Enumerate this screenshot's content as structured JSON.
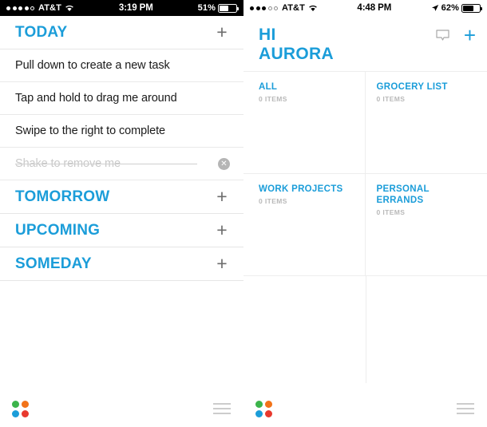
{
  "left_phone": {
    "status_bar": {
      "signal_dots_filled": 4,
      "signal_dots_total": 5,
      "carrier": "AT&T",
      "wifi_icon": "wifi-icon",
      "time": "3:19 PM",
      "battery_percent": "51%",
      "battery_level": 51,
      "theme": "dark"
    },
    "sections": [
      {
        "title": "TODAY",
        "add_icon": "plus-icon",
        "tasks": [
          {
            "text": "Pull down to create a new task",
            "done": false
          },
          {
            "text": "Tap and hold to drag me around",
            "done": false
          },
          {
            "text": "Swipe to the right to complete",
            "done": false
          },
          {
            "text": "Shake to remove me",
            "done": true,
            "clear_icon": "close-circle-icon",
            "clear_label": "✕"
          }
        ]
      },
      {
        "title": "TOMORROW",
        "add_icon": "plus-icon",
        "tasks": []
      },
      {
        "title": "UPCOMING",
        "add_icon": "plus-icon",
        "tasks": []
      },
      {
        "title": "SOMEDAY",
        "add_icon": "plus-icon",
        "tasks": []
      }
    ],
    "bottom_bar": {
      "logo_name": "app-logo",
      "logo_colors": [
        "#3cb44b",
        "#f27319",
        "#1b9dd9",
        "#e8392e"
      ],
      "menu_icon": "hamburger-menu-icon"
    }
  },
  "right_phone": {
    "status_bar": {
      "signal_dots_filled": 3,
      "signal_dots_total": 5,
      "carrier": "AT&T",
      "wifi_icon": "wifi-icon",
      "time": "4:48 PM",
      "location_icon": "location-arrow-icon",
      "battery_percent": "62%",
      "battery_level": 62,
      "theme": "light"
    },
    "header": {
      "greeting_line1": "HI",
      "greeting_line2": "AURORA",
      "message_icon": "speech-bubble-icon",
      "add_icon": "plus-icon"
    },
    "lists": [
      {
        "name": "ALL",
        "count": "0 ITEMS"
      },
      {
        "name": "GROCERY LIST",
        "count": "0 ITEMS"
      },
      {
        "name": "WORK PROJECTS",
        "count": "0 ITEMS"
      },
      {
        "name": "PERSONAL ERRANDS",
        "count": "0 ITEMS"
      }
    ],
    "bottom_bar": {
      "logo_name": "app-logo",
      "logo_colors": [
        "#3cb44b",
        "#f27319",
        "#1b9dd9",
        "#e8392e"
      ],
      "menu_icon": "hamburger-menu-icon"
    }
  },
  "theme": {
    "accent_blue": "#1b9dd9",
    "task_text": "#1a1a1a",
    "done_text": "#c9c9c9",
    "divider": "#e9e9e9",
    "muted": "#b9b9b9"
  }
}
